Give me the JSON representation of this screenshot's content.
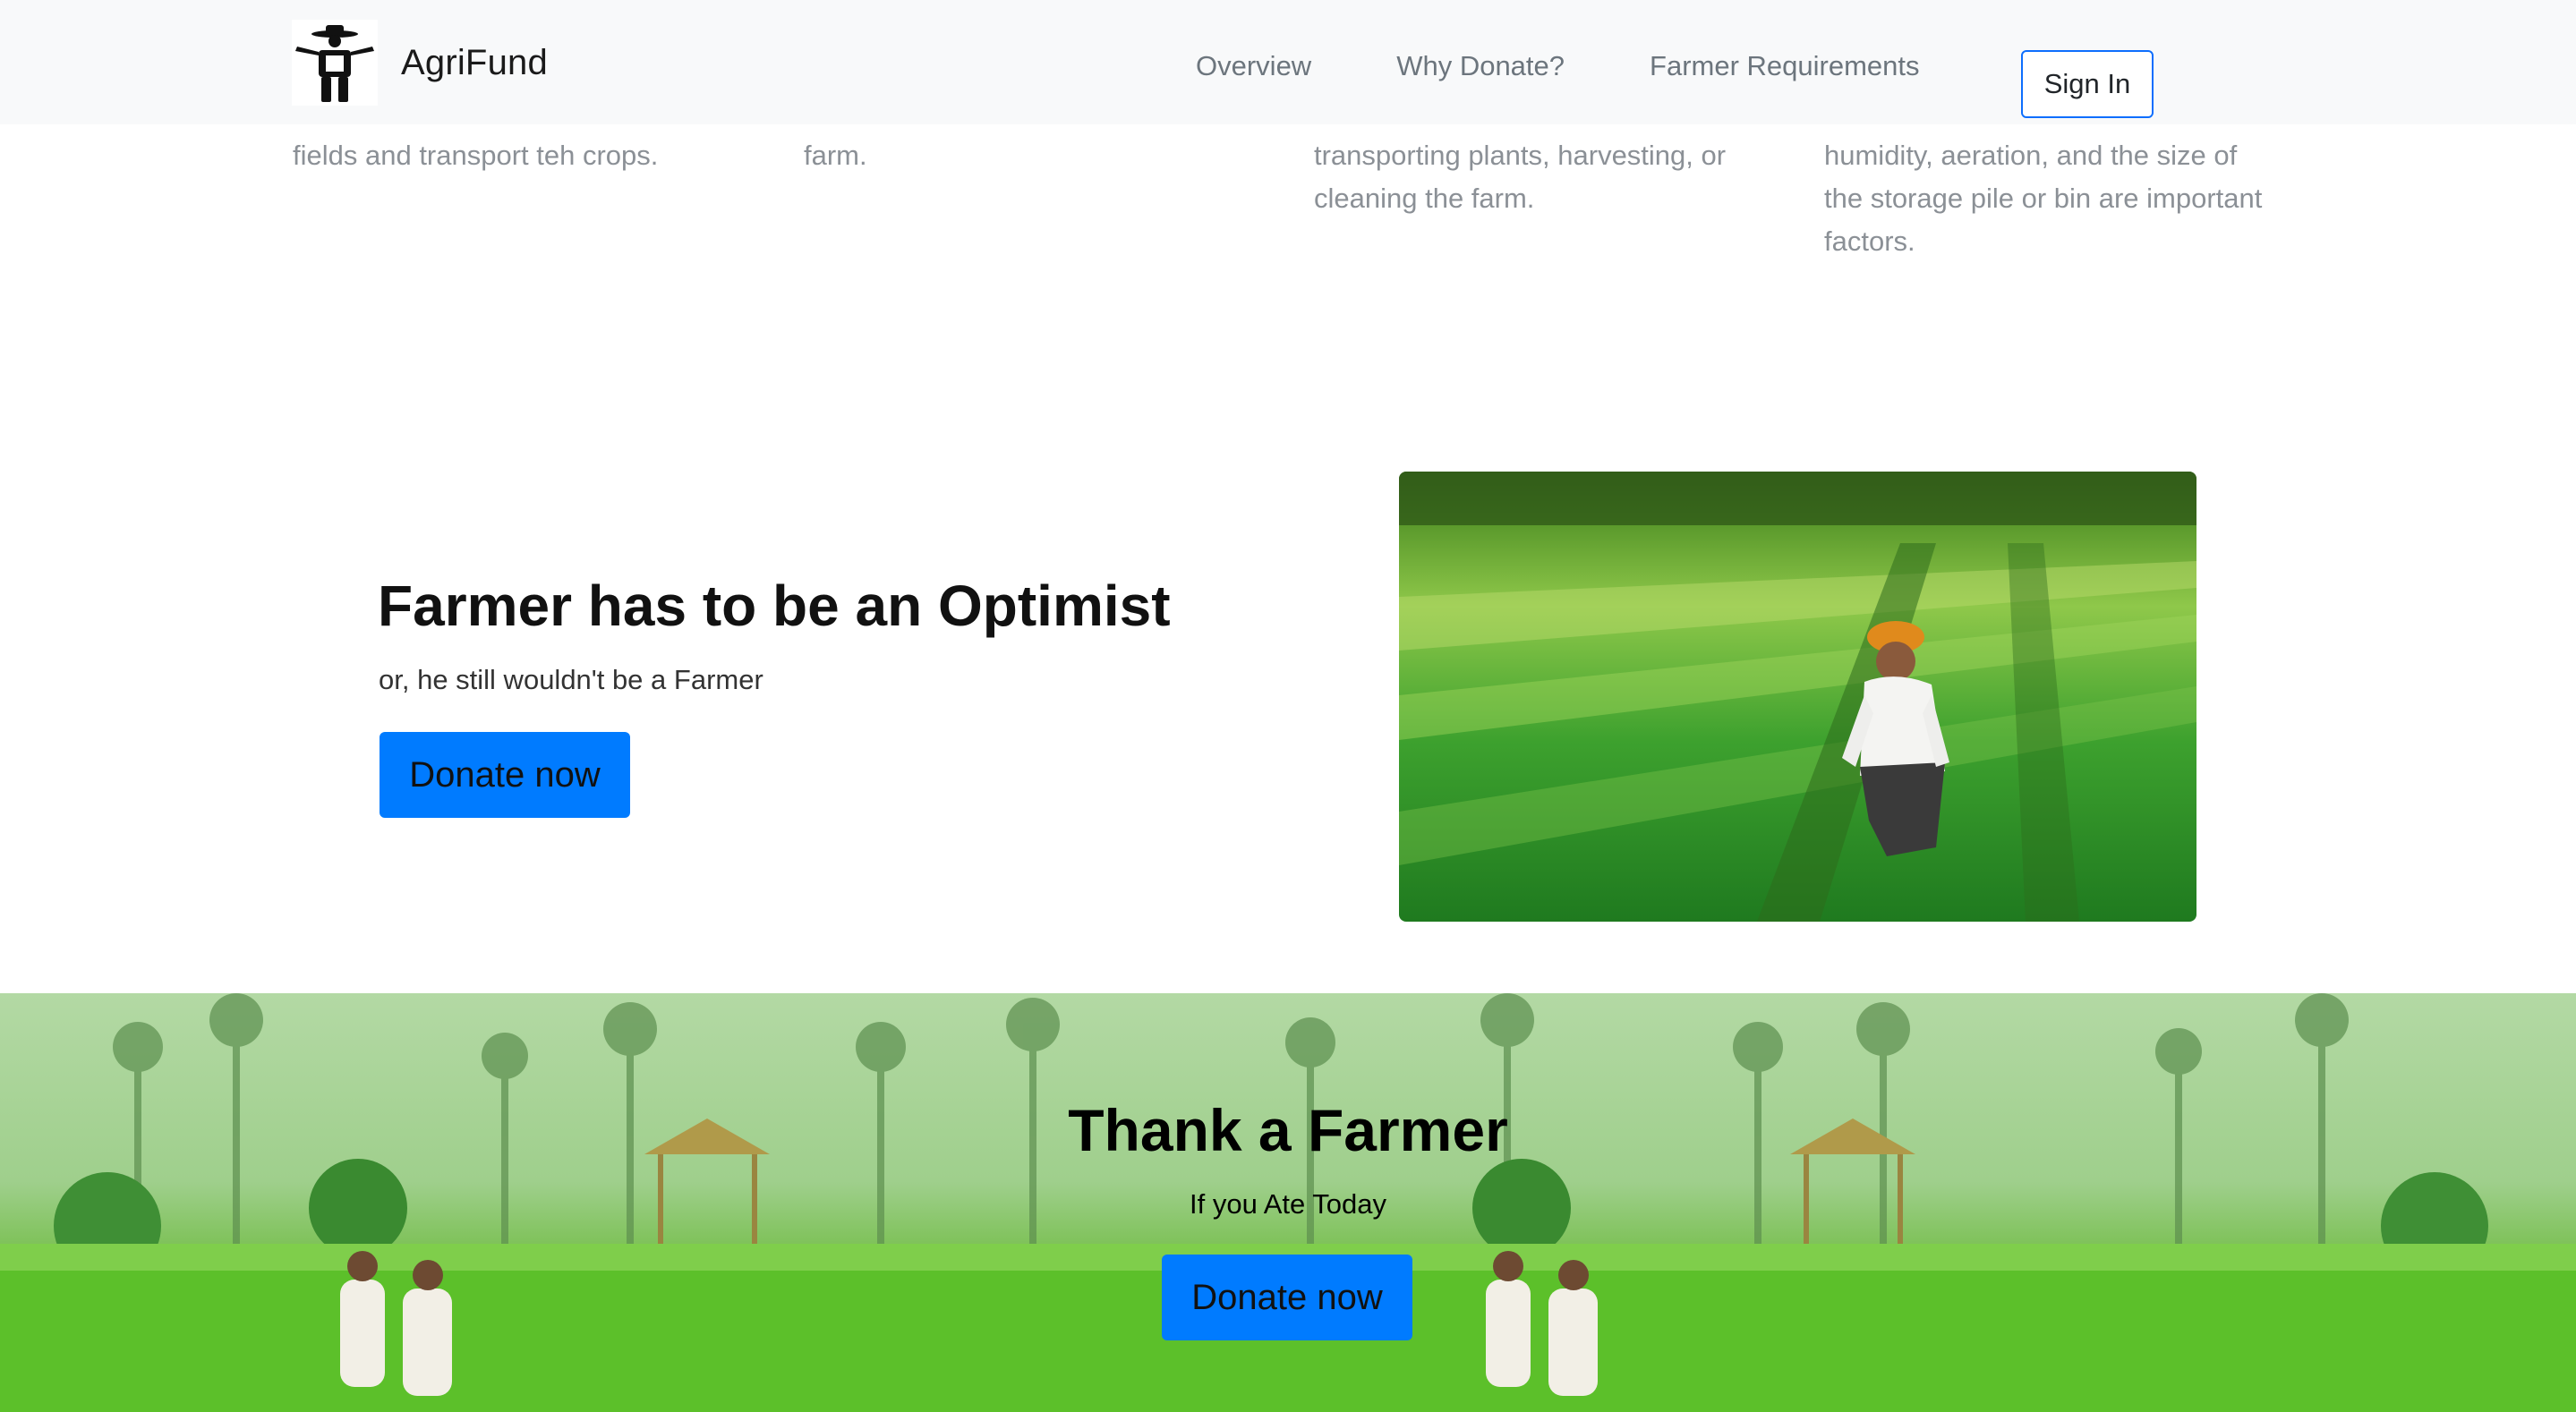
{
  "navbar": {
    "brand_name": "AgriFund",
    "links": [
      "Overview",
      "Why Donate?",
      "Farmer Requirements"
    ],
    "signin_label": "Sign In"
  },
  "features": {
    "col1": [
      "fields and transport teh crops."
    ],
    "col2": [
      "farm."
    ],
    "col3": [
      "transporting plants, harvesting, or",
      "cleaning the farm."
    ],
    "col4": [
      "humidity, aeration, and the size of",
      "the storage pile or bin are important",
      "factors."
    ]
  },
  "hero": {
    "title": "Farmer has to be an Optimist",
    "subtitle": "or, he still wouldn't be a Farmer",
    "button_label": "Donate now"
  },
  "banner": {
    "title": "Thank a Farmer",
    "subtitle": "If you Ate Today",
    "button_label": "Donate now"
  },
  "colors": {
    "accent": "#007bff",
    "signin_border": "#0d6efd",
    "navbar_bg": "#f8f9fa",
    "muted_text": "#8b9096"
  },
  "icons": {
    "brand_logo": "farmer-logo-icon"
  }
}
